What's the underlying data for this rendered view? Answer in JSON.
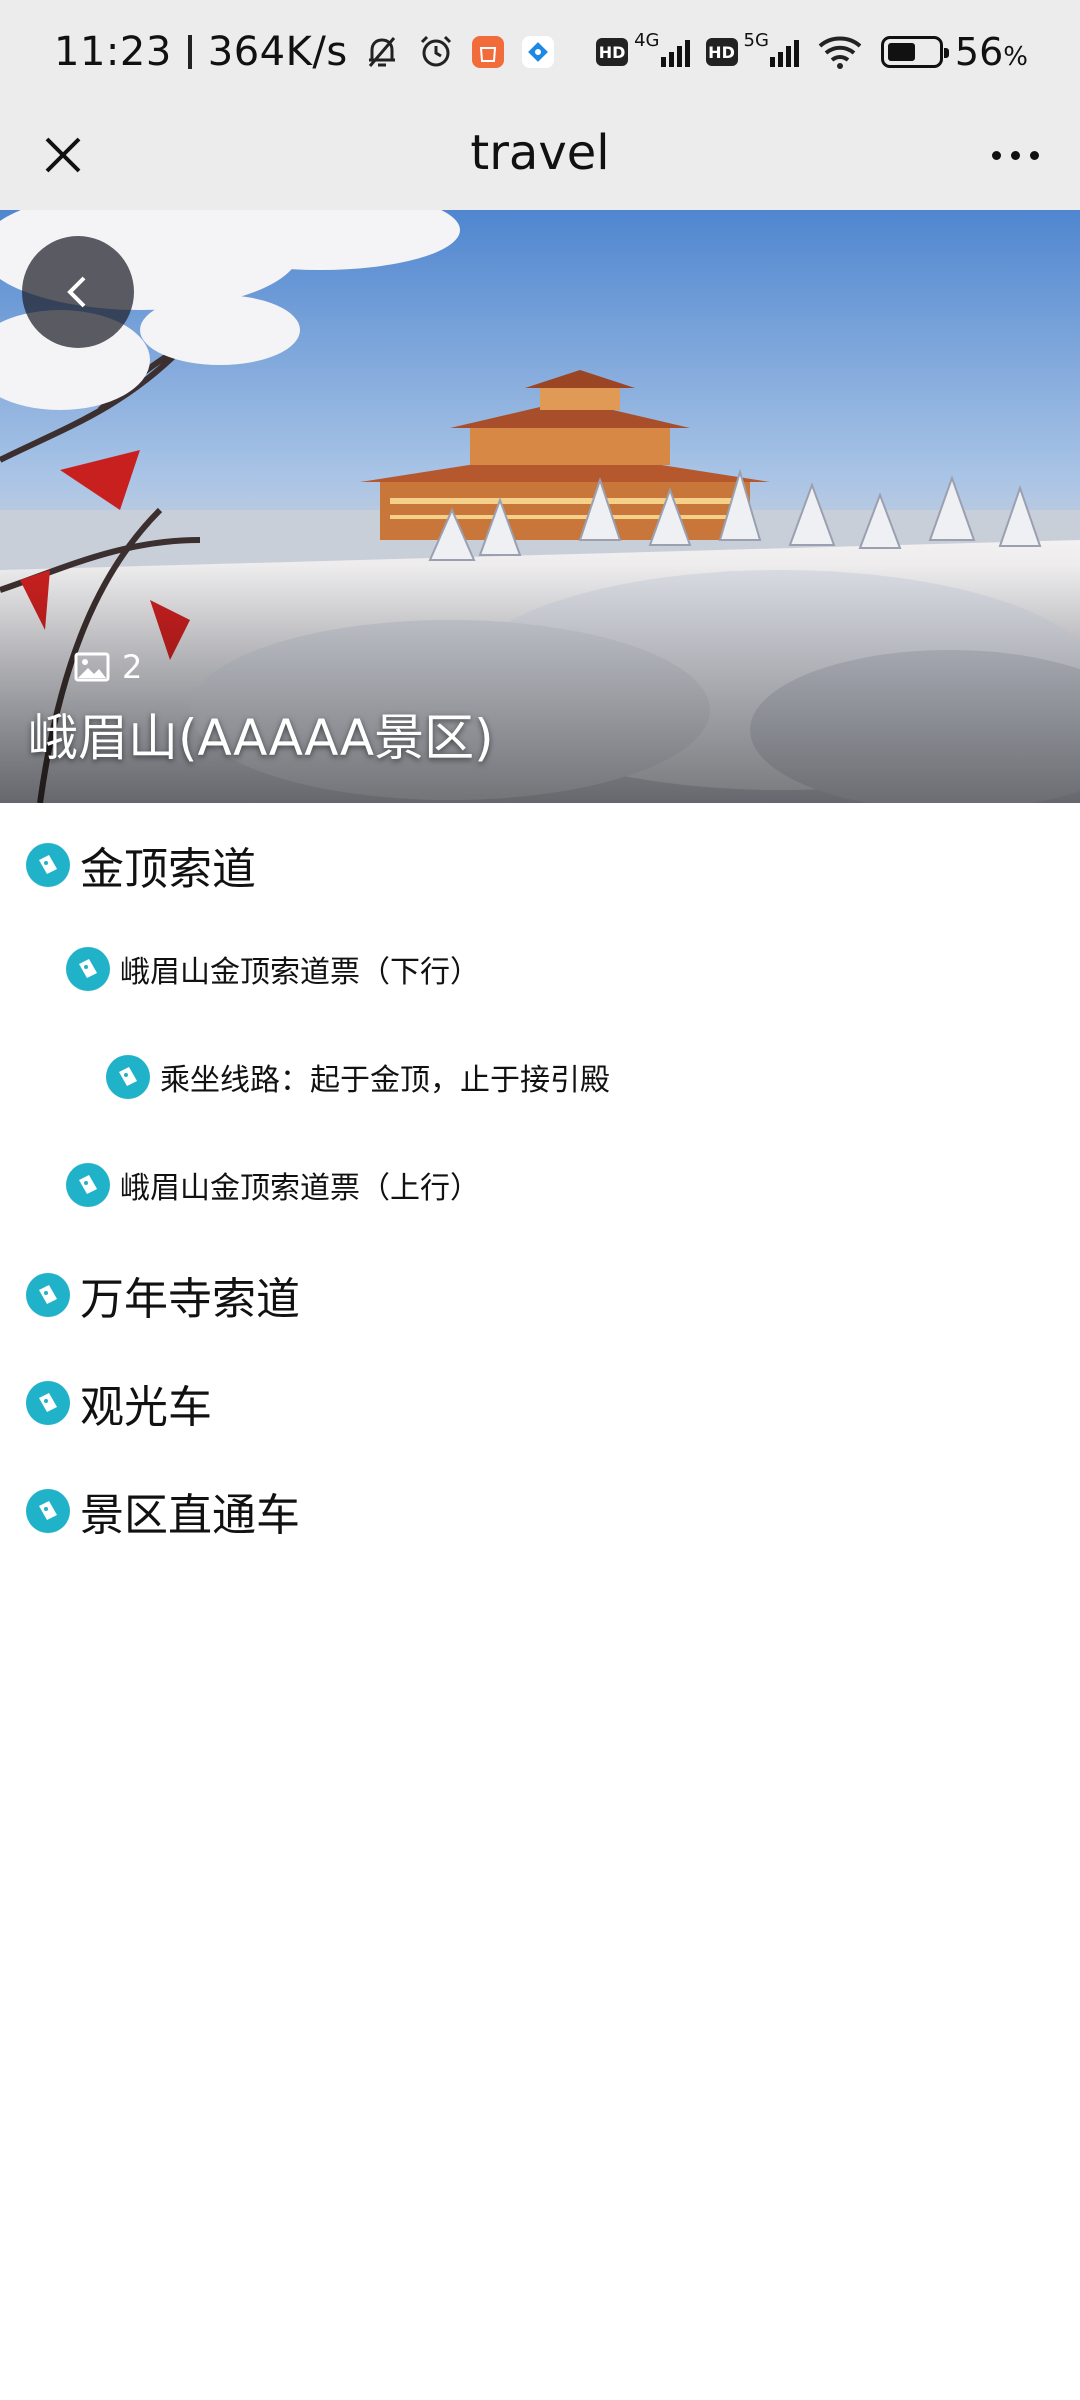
{
  "status_bar": {
    "time": "11:23",
    "speed": "364K/s",
    "network_1": "4G",
    "network_2": "5G",
    "hd_label": "HD",
    "battery_value": "56",
    "battery_unit": "%",
    "battery_level": 0.56
  },
  "titlebar": {
    "title": "travel"
  },
  "hero": {
    "photo_count": "2",
    "title": "峨眉山(AAAAA景区)"
  },
  "list": {
    "items": [
      {
        "label": "金顶索道",
        "level": 1
      },
      {
        "label": "峨眉山金顶索道票（下行）",
        "level": 2
      },
      {
        "label": "乘坐线路：起于金顶，止于接引殿",
        "level": 3
      },
      {
        "label": "峨眉山金顶索道票（上行）",
        "level": 2
      },
      {
        "label": "万年寺索道",
        "level": 1
      },
      {
        "label": "观光车",
        "level": 1
      },
      {
        "label": "景区直通车",
        "level": 1
      }
    ]
  },
  "colors": {
    "accent": "#1fb2c9",
    "header_bg": "#ececec"
  },
  "icons": {
    "close": "close-icon",
    "more": "more-icon",
    "back": "chevron-left-icon",
    "gallery": "image-icon",
    "list_item": "ticket-icon"
  }
}
